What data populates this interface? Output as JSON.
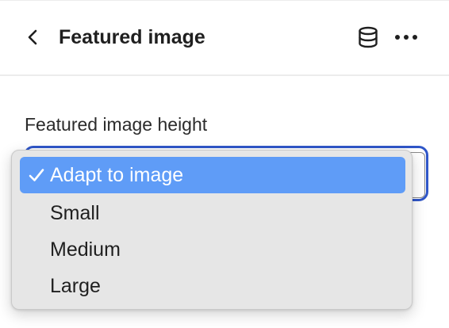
{
  "header": {
    "title": "Featured image",
    "back_icon": "chevron-left-icon",
    "data_source_icon": "database-icon",
    "more_icon": "more-horizontal-icon"
  },
  "field": {
    "label": "Featured image height",
    "selected_value": "Adapt to image",
    "focus_color": "#2f56c8"
  },
  "dropdown": {
    "highlight_color": "#5f9cf7",
    "options": [
      {
        "label": "Adapt to image",
        "selected": true
      },
      {
        "label": "Small",
        "selected": false
      },
      {
        "label": "Medium",
        "selected": false
      },
      {
        "label": "Large",
        "selected": false
      }
    ]
  }
}
